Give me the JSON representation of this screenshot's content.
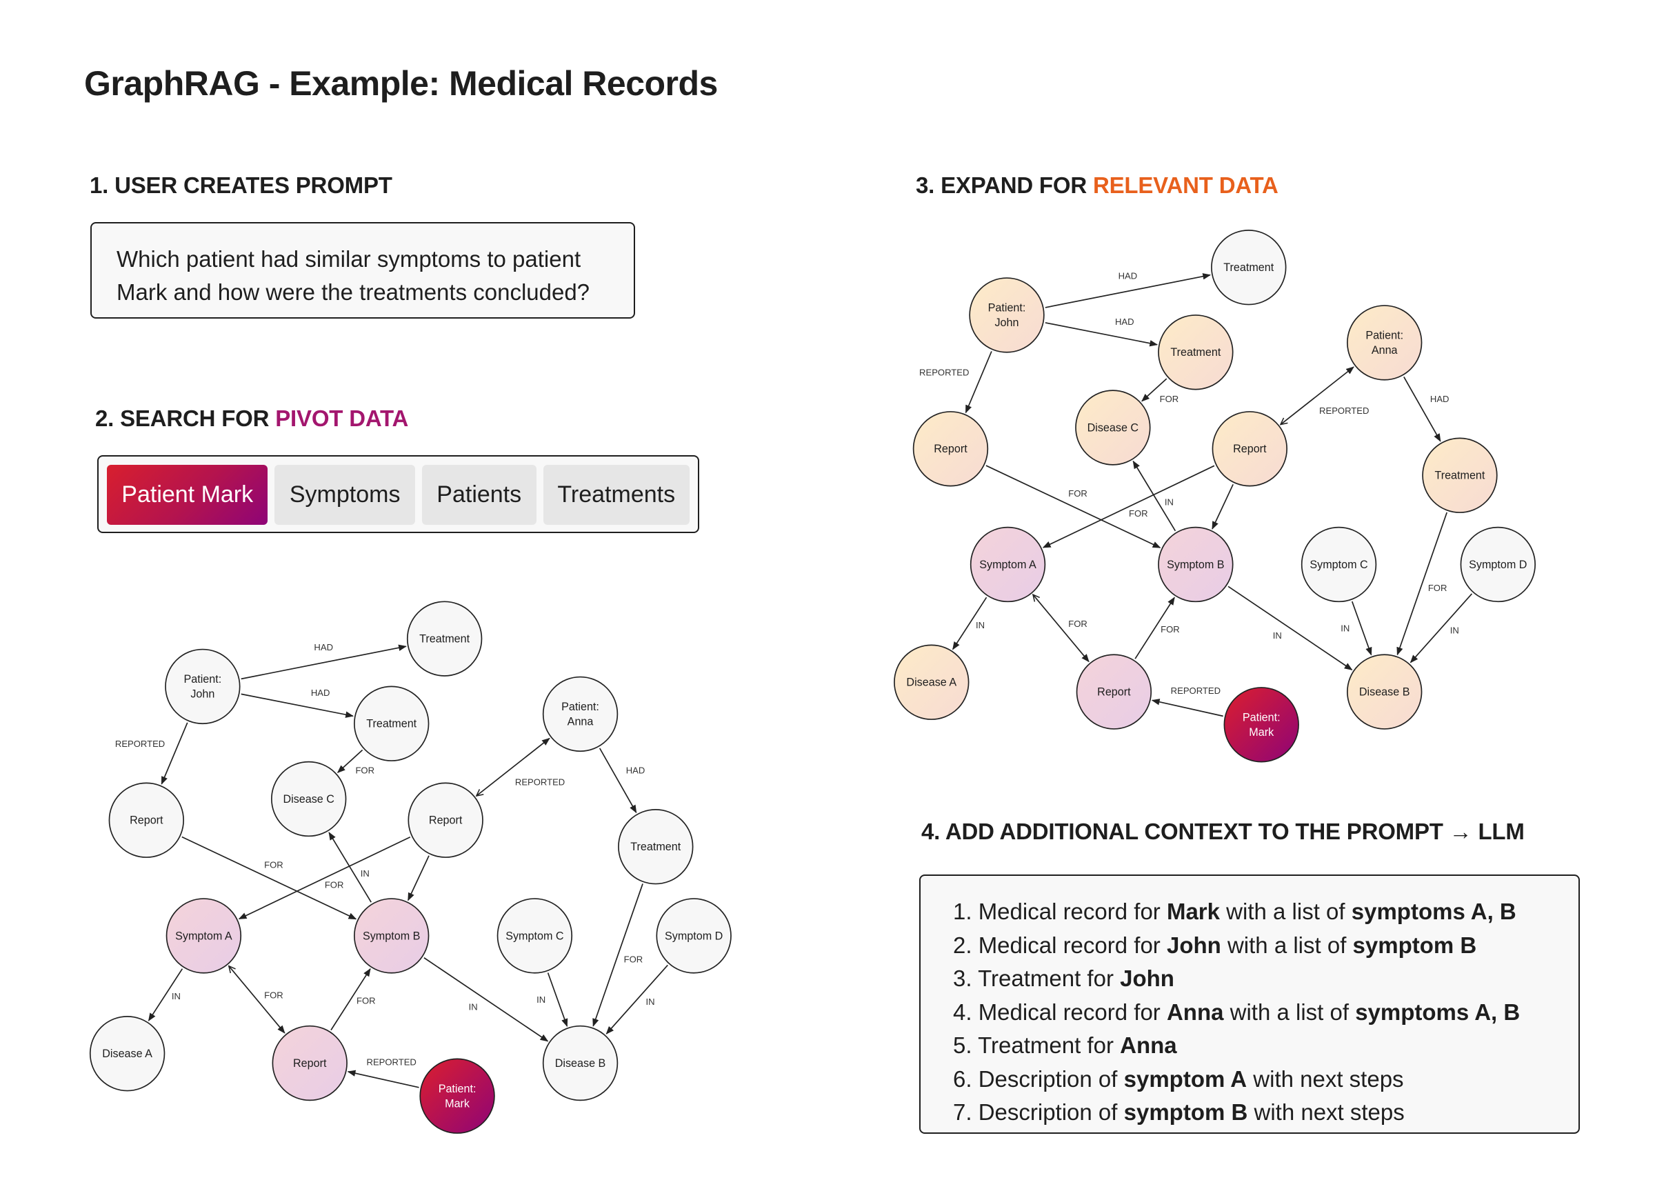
{
  "title": "GraphRAG - Example: Medical Records",
  "steps": {
    "step1": {
      "heading": "1. USER CREATES PROMPT",
      "prompt_lines": [
        "Which patient had similar symptoms to patient",
        "Mark and how were the treatments concluded?"
      ]
    },
    "step2": {
      "heading_prefix": "2. SEARCH FOR ",
      "heading_accent": "PIVOT DATA",
      "accent_color": "#a3166e",
      "chips": [
        {
          "label": "Patient Mark",
          "active": true
        },
        {
          "label": "Symptoms",
          "active": false
        },
        {
          "label": "Patients",
          "active": false
        },
        {
          "label": "Treatments",
          "active": false
        }
      ]
    },
    "step3": {
      "heading_prefix": "3. EXPAND FOR ",
      "heading_accent": "RELEVANT DATA",
      "accent_color": "#e8601c"
    },
    "step4": {
      "heading": "4. ADD ADDITIONAL CONTEXT TO THE PROMPT → LLM",
      "items": [
        [
          {
            "t": "1. Medical record for "
          },
          {
            "t": "Mark",
            "b": true
          },
          {
            "t": " with a list of "
          },
          {
            "t": "symptoms A, B",
            "b": true
          }
        ],
        [
          {
            "t": "2. Medical record for "
          },
          {
            "t": "John",
            "b": true
          },
          {
            "t": " with a list of "
          },
          {
            "t": "symptom B",
            "b": true
          }
        ],
        [
          {
            "t": "3. Treatment for "
          },
          {
            "t": "John",
            "b": true
          }
        ],
        [
          {
            "t": "4. Medical record for "
          },
          {
            "t": "Anna",
            "b": true
          },
          {
            "t": " with a list of "
          },
          {
            "t": "symptoms A, B",
            "b": true
          }
        ],
        [
          {
            "t": "5. Treatment for "
          },
          {
            "t": "Anna",
            "b": true
          }
        ],
        [
          {
            "t": "6. Description of "
          },
          {
            "t": "symptom A",
            "b": true
          },
          {
            "t": " with next steps"
          }
        ],
        [
          {
            "t": "7. Description of "
          },
          {
            "t": "symptom B",
            "b": true
          },
          {
            "t": " with next steps"
          }
        ]
      ]
    }
  },
  "node_styles": {
    "plain": {
      "fill": "#f7f7f7"
    },
    "pivot": {
      "fill": [
        "#f4d3da",
        "#e8cde6"
      ]
    },
    "relevant": {
      "fill": [
        "#fdebc8",
        "#f7dbd3"
      ]
    },
    "source": {
      "fill": [
        "#dc1f2e",
        "#8e0477"
      ],
      "text": "#ffffff"
    }
  },
  "graph": {
    "nodes": [
      {
        "id": "john",
        "label": [
          "Patient:",
          "John"
        ]
      },
      {
        "id": "treat1",
        "label": [
          "Treatment"
        ]
      },
      {
        "id": "treat2",
        "label": [
          "Treatment"
        ]
      },
      {
        "id": "anna",
        "label": [
          "Patient:",
          "Anna"
        ]
      },
      {
        "id": "report1",
        "label": [
          "Report"
        ]
      },
      {
        "id": "diseaseC",
        "label": [
          "Disease C"
        ]
      },
      {
        "id": "report2",
        "label": [
          "Report"
        ]
      },
      {
        "id": "treatAnna",
        "label": [
          "Treatment"
        ]
      },
      {
        "id": "symA",
        "label": [
          "Symptom A"
        ]
      },
      {
        "id": "symB",
        "label": [
          "Symptom B"
        ]
      },
      {
        "id": "symC",
        "label": [
          "Symptom C"
        ]
      },
      {
        "id": "symD",
        "label": [
          "Symptom D"
        ]
      },
      {
        "id": "diseaseA",
        "label": [
          "Disease A"
        ]
      },
      {
        "id": "report3",
        "label": [
          "Report"
        ]
      },
      {
        "id": "mark",
        "label": [
          "Patient:",
          "Mark"
        ]
      },
      {
        "id": "diseaseB",
        "label": [
          "Disease B"
        ]
      }
    ],
    "edges": [
      {
        "from": "john",
        "to": "treat1",
        "label": "HAD"
      },
      {
        "from": "john",
        "to": "treat2",
        "label": "HAD"
      },
      {
        "from": "john",
        "to": "report1",
        "label": "REPORTED"
      },
      {
        "from": "treat2",
        "to": "diseaseC",
        "label": "FOR"
      },
      {
        "from": "report2",
        "to": "anna",
        "label": "REPORTED",
        "both": true
      },
      {
        "from": "anna",
        "to": "treatAnna",
        "label": "HAD"
      },
      {
        "from": "report1",
        "to": "symB",
        "label": "FOR"
      },
      {
        "from": "report2",
        "to": "symA",
        "label": "FOR"
      },
      {
        "from": "symB",
        "to": "diseaseC",
        "label": "IN"
      },
      {
        "from": "report2",
        "to": "symB",
        "label": ""
      },
      {
        "from": "symA",
        "to": "diseaseA",
        "label": "IN"
      },
      {
        "from": "symA",
        "to": "report3",
        "label": "FOR",
        "both": true
      },
      {
        "from": "report3",
        "to": "symB",
        "label": "FOR"
      },
      {
        "from": "mark",
        "to": "report3",
        "label": "REPORTED"
      },
      {
        "from": "symB",
        "to": "diseaseB",
        "label": "IN"
      },
      {
        "from": "symC",
        "to": "diseaseB",
        "label": "IN"
      },
      {
        "from": "treatAnna",
        "to": "diseaseB",
        "label": "FOR"
      },
      {
        "from": "symD",
        "to": "diseaseB",
        "label": "IN"
      }
    ],
    "search_view": {
      "styles": {
        "symA": "pivot",
        "symB": "pivot",
        "report3": "pivot",
        "mark": "source"
      }
    },
    "expand_view": {
      "styles": {
        "john": "relevant",
        "treat2": "relevant",
        "anna": "relevant",
        "report1": "relevant",
        "diseaseC": "relevant",
        "report2": "relevant",
        "treatAnna": "relevant",
        "diseaseA": "relevant",
        "diseaseB": "relevant",
        "symA": "pivot",
        "symB": "pivot",
        "report3": "pivot",
        "mark": "source"
      }
    }
  }
}
